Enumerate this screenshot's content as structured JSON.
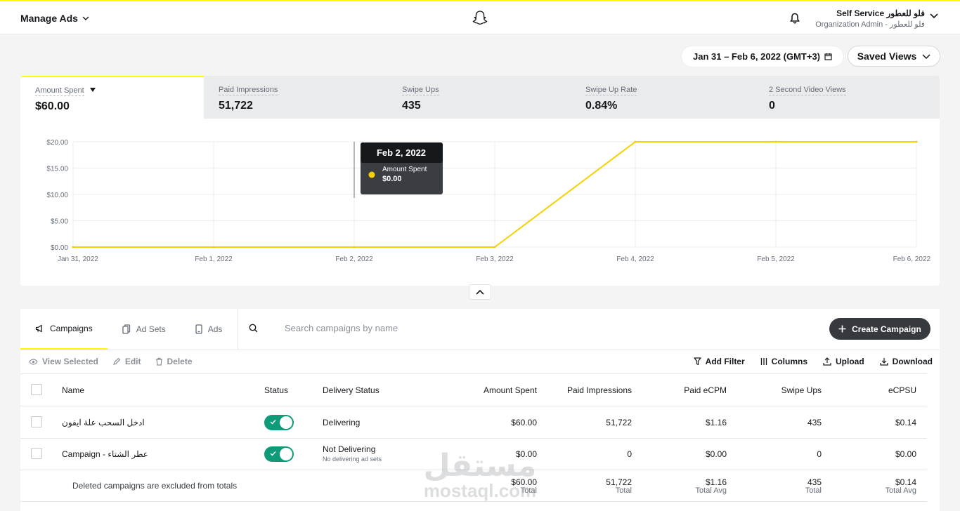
{
  "header": {
    "manage_ads": "Manage Ads",
    "account_name": "Self Service فلو للعطور",
    "account_role": "Organization Admin - فلو للعطور"
  },
  "toolbar": {
    "date_range": "Jan 31 – Feb 6, 2022 (GMT+3)",
    "saved_views": "Saved Views"
  },
  "metrics": [
    {
      "label": "Amount Spent",
      "value": "$60.00",
      "active": true
    },
    {
      "label": "Paid Impressions",
      "value": "51,722"
    },
    {
      "label": "Swipe Ups",
      "value": "435"
    },
    {
      "label": "Swipe Up Rate",
      "value": "0.84%"
    },
    {
      "label": "2 Second Video Views",
      "value": "0"
    }
  ],
  "chart_data": {
    "type": "line",
    "categories": [
      "Jan 31, 2022",
      "Feb 1, 2022",
      "Feb 2, 2022",
      "Feb 3, 2022",
      "Feb 4, 2022",
      "Feb 5, 2022",
      "Feb 6, 2022"
    ],
    "series": [
      {
        "name": "Amount Spent",
        "values": [
          0,
          0,
          0,
          0,
          20,
          20,
          20
        ],
        "color": "#f7d000"
      }
    ],
    "yticks": [
      "$0.00",
      "$5.00",
      "$10.00",
      "$15.00",
      "$20.00"
    ],
    "ylim": [
      0,
      20
    ],
    "grid": true,
    "tooltip": {
      "date": "Feb 2, 2022",
      "label": "Amount Spent",
      "value": "$0.00"
    }
  },
  "tabs": {
    "campaigns": "Campaigns",
    "adsets": "Ad Sets",
    "ads": "Ads"
  },
  "search": {
    "placeholder": "Search campaigns by name"
  },
  "create_campaign": "Create Campaign",
  "actions": {
    "view_selected": "View Selected",
    "edit": "Edit",
    "delete": "Delete",
    "add_filter": "Add Filter",
    "columns": "Columns",
    "upload": "Upload",
    "download": "Download"
  },
  "table": {
    "columns": {
      "name": "Name",
      "status": "Status",
      "delivery": "Delivery Status",
      "amount": "Amount Spent",
      "impressions": "Paid Impressions",
      "ecpm": "Paid eCPM",
      "swipe_ups": "Swipe Ups",
      "ecpsu": "eCPSU"
    },
    "rows": [
      {
        "name": "ادخل السحب علة ايفون",
        "status_on": true,
        "delivery": "Delivering",
        "delivery_sub": "",
        "amount": "$60.00",
        "impressions": "51,722",
        "ecpm": "$1.16",
        "swipe_ups": "435",
        "ecpsu": "$0.14"
      },
      {
        "name": "Campaign - عطر الشتاء",
        "status_on": true,
        "delivery": "Not Delivering",
        "delivery_sub": "No delivering ad sets",
        "amount": "$0.00",
        "impressions": "0",
        "ecpm": "$0.00",
        "swipe_ups": "0",
        "ecpsu": "$0.00"
      }
    ],
    "totals": {
      "note": "Deleted campaigns are excluded from totals",
      "amount": "$60.00",
      "amount_label": "Total",
      "impressions": "51,722",
      "impressions_label": "Total",
      "ecpm": "$1.16",
      "ecpm_label": "Total Avg",
      "swipe_ups": "435",
      "swipe_ups_label": "Total",
      "ecpsu": "$0.14",
      "ecpsu_label": "Total Avg"
    }
  },
  "watermark": {
    "text_ar": "مستقل",
    "text_en": "mostaql.com"
  }
}
